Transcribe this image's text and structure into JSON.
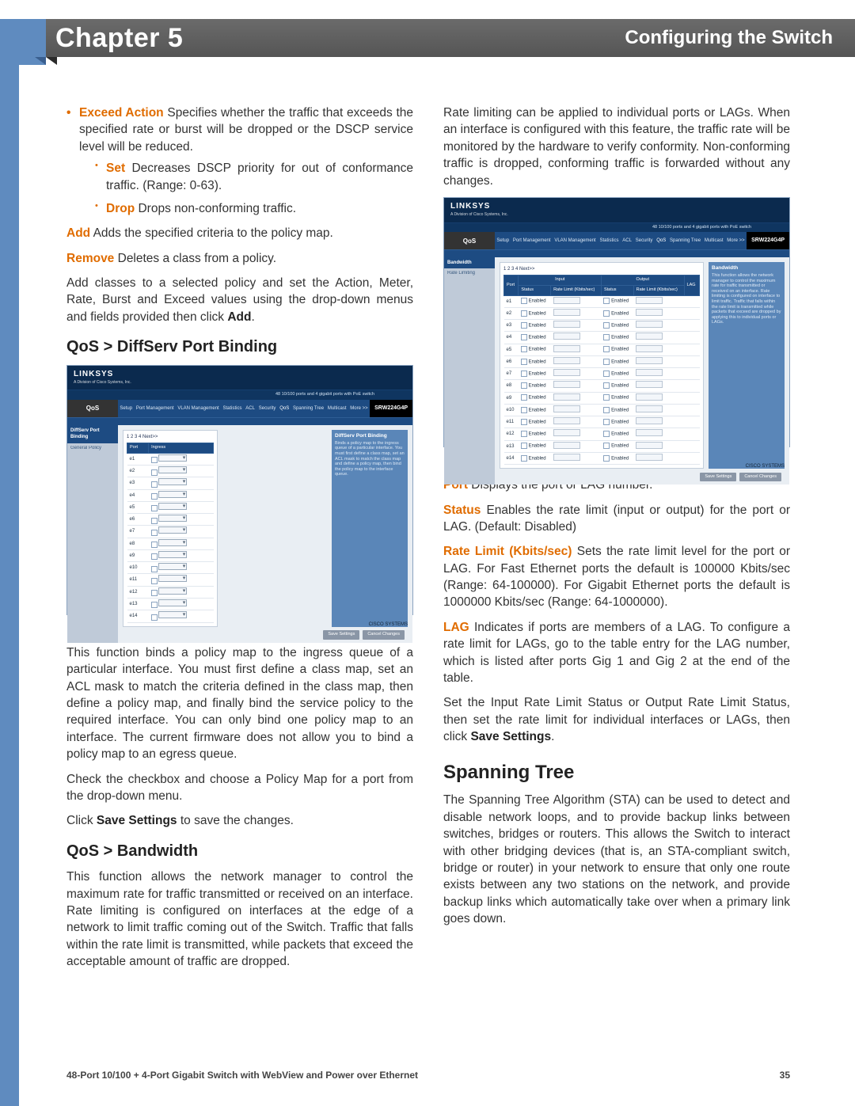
{
  "header": {
    "chapter": "Chapter 5",
    "title": "Configuring the Switch"
  },
  "left": {
    "bullets0": {
      "item1_label": "Exceed Action",
      "item1_text": "  Specifies whether the traffic that exceeds the specified rate or burst will be dropped or the DSCP service level will be reduced.",
      "sub1_label": "Set",
      "sub1_text": "  Decreases DSCP priority for out of conformance traffic. (Range: 0-63).",
      "sub2_label": "Drop",
      "sub2_text": "  Drops non-conforming traffic."
    },
    "add_label": "Add",
    "add_text": "  Adds the specified criteria to the policy map.",
    "remove_label": "Remove",
    "remove_text": "  Deletes a class from a policy.",
    "para1": "Add classes to a selected policy and set the Action, Meter, Rate, Burst and Exceed values using the drop-down menus and fields provided then click ",
    "para1_bold": "Add",
    "sec1": "QoS > DiffServ Port Binding",
    "caption1": "QoS > DiffServ Port Binding",
    "para2": "This function binds a policy map to the ingress queue of a particular interface. You must first define a class map, set an ACL mask to match the criteria defined in the class map, then define a policy map, and finally bind the service policy to the required interface. You can only bind one policy map to an interface. The current firmware does not allow you to bind a policy map to an egress queue.",
    "para3": "Check the checkbox and choose a Policy Map for a port from the drop-down menu.",
    "para4a": "Click ",
    "para4b": "Save Settings",
    "para4c": " to save the changes.",
    "sec2": "QoS > Bandwidth",
    "para5": "This function allows the network manager to control the maximum rate for traffic transmitted or received on an interface. Rate limiting is configured on interfaces at the edge of a network to limit traffic coming out of the Switch. Traffic that falls within the rate limit is transmitted, while packets that exceed the acceptable amount of traffic are dropped."
  },
  "right": {
    "para1": "Rate limiting can be applied to individual ports or LAGs. When an interface is configured with this feature, the traffic rate will be monitored by the hardware to verify conformity. Non-conforming traffic is dropped, conforming traffic is forwarded without any changes.",
    "caption": "QoS > Bandwidth",
    "port_label": "Port",
    "port_text": "  Displays the port or LAG number.",
    "status_label": "Status",
    "status_text": "  Enables the rate limit (input or output) for the port or LAG. (Default: Disabled)",
    "rate_label": "Rate Limit (Kbits/sec)",
    "rate_text": "  Sets the rate limit level for the port or LAG. For Fast Ethernet ports the default is 100000 Kbits/sec (Range: 64-100000). For Gigabit Ethernet ports the default is 1000000 Kbits/sec (Range: 64-1000000).",
    "lag_label": "LAG",
    "lag_text": "  Indicates if ports are members of a LAG. To configure a rate limit for LAGs, go to the table entry for the LAG number, which is listed after ports Gig 1 and Gig 2 at the end of the table.",
    "para5a": "Set the Input Rate Limit Status or Output Rate Limit Status, then set the rate limit for individual interfaces or LAGs, then click ",
    "para5b": "Save Settings",
    "para5c": ".",
    "sec_st": "Spanning Tree",
    "para6": "The Spanning Tree Algorithm (STA) can be used to detect and disable network loops, and to provide backup links between switches, bridges or routers. This allows the Switch to interact with other bridging devices (that is, an STA-compliant switch, bridge or router) in your network to ensure that only one route exists between any two stations on the network, and provide backup links which automatically take over when a primary link goes down."
  },
  "shot_common": {
    "brand": "LINKSYS",
    "brand_sub": "A Division of Cisco Systems, Inc.",
    "model": "SRW224G4P",
    "tab_main": "QoS",
    "tabs": [
      "Setup",
      "Port Management",
      "VLAN Management",
      "Statistics",
      "ACL",
      "Security",
      "QoS",
      "Spanning Tree",
      "Multicast",
      "More >>"
    ],
    "top_desc": "48 10/100 ports and 4 gigabit ports with PoE switch",
    "save_btn": "Save Settings",
    "cancel_btn": "Cancel Changes",
    "cisco": "CISCO SYSTEMS"
  },
  "shot1": {
    "side_active": "DiffServ Port Binding",
    "side_sub": "General Policy",
    "pager": "1 2 3 4  Next>>",
    "cols": [
      "Port",
      "Ingress"
    ],
    "rows": [
      "e1",
      "e2",
      "e3",
      "e4",
      "e5",
      "e6",
      "e7",
      "e8",
      "e9",
      "e10",
      "e11",
      "e12",
      "e13",
      "e14"
    ],
    "help_title": "DiffServ Port Binding",
    "help_body": "Binds a policy map to the ingress queue of a particular interface. You must first define a class map, set an ACL mask to match the class map and define a policy map, then bind the policy map to the interface queue."
  },
  "shot2": {
    "side_active": "Bandwidth",
    "side_sub": "Rate Limiting",
    "pager": "1 2 3 4  Next>>",
    "group_in": "Input",
    "group_out": "Output",
    "cols": [
      "Port",
      "Status",
      "Rate Limit (Kbits/sec)",
      "Status",
      "Rate Limit (Kbits/sec)",
      "LAG"
    ],
    "rows": [
      "e1",
      "e2",
      "e3",
      "e4",
      "e5",
      "e6",
      "e7",
      "e8",
      "e9",
      "e10",
      "e11",
      "e12",
      "e13",
      "e14"
    ],
    "help_title": "Bandwidth",
    "help_body": "This function allows the network manager to control the maximum rate for traffic transmitted or received on an interface. Rate limiting is configured on interface to limit traffic. Traffic that falls within the rate limit is transmitted while packets that exceed are dropped by applying this to individual ports or LAGs."
  },
  "footer": {
    "title": "48-Port 10/100 + 4-Port Gigabit Switch with WebView and Power over Ethernet",
    "page": "35"
  }
}
